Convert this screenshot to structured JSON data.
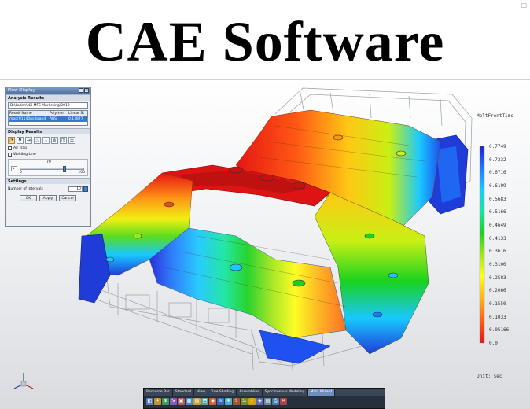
{
  "banner": {
    "title": "CAE Software"
  },
  "flow_panel": {
    "title": "Flow Display",
    "analysis_results_header": "Analysis Results",
    "path_value": "D:\\Laden\\NX-MFS Marketing\\2012",
    "table_headers": [
      "Result Name",
      "Polymer",
      "Linear St"
    ],
    "table_row": [
      "mpp(01140ns-brand",
      "ABS",
      "0.13877"
    ],
    "display_results_header": "Display Results",
    "air_trap_label": "Air Trap",
    "welding_line_label": "Welding Line",
    "slider": {
      "value": "70",
      "min": "0",
      "max": "100",
      "fraction": 0.7
    },
    "settings_header": "Settings",
    "intervals_label": "Number of Intervals",
    "intervals_value": "10",
    "ok_label": "OK",
    "apply_label": "Apply",
    "cancel_label": "Cancel"
  },
  "legend": {
    "title": "MeltFrontTime",
    "values": [
      "0.7749",
      "0.7232",
      "0.6716",
      "0.6199",
      "0.5683",
      "0.5166",
      "0.4649",
      "0.4133",
      "0.3616",
      "0.3100",
      "0.2583",
      "0.2066",
      "0.1550",
      "0.1033",
      "0.05166",
      "0.0"
    ],
    "unit": "Unit: sec",
    "colors": [
      "#1f1fd8",
      "#1f78ff",
      "#19c8ff",
      "#14e6a0",
      "#19d21e",
      "#a0e619",
      "#ffff14",
      "#ffb414",
      "#ff6414",
      "#e61414"
    ]
  },
  "toolbar": {
    "tabs": [
      "Resource Bar",
      "Standard",
      "View",
      "True Shading",
      "Assemblies",
      "Synchronous Modeling",
      "Mold Wizard"
    ],
    "active_tab": "Mold Wizard",
    "icons": [
      "part-icon",
      "init-icon",
      "csys-icon",
      "shrink-icon",
      "workpiece-icon",
      "layout-icon",
      "family-icon",
      "insert-icon",
      "gate-icon",
      "runner-icon",
      "cool-icon",
      "ejector-icon",
      "slide-icon",
      "electrode-icon",
      "analysis-icon",
      "report-icon",
      "save-icon",
      "close-icon"
    ]
  },
  "corner_mark": "□"
}
